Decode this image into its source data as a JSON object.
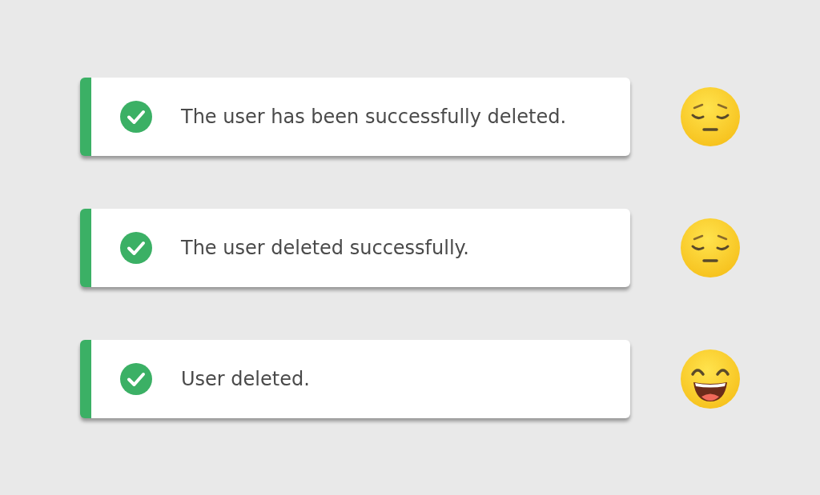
{
  "notifications": [
    {
      "text": "The user has been successfully deleted.",
      "kind": "pensive"
    },
    {
      "text": "The user deleted successfully.",
      "kind": "pensive"
    },
    {
      "text": "User deleted.",
      "kind": "laughing"
    }
  ]
}
